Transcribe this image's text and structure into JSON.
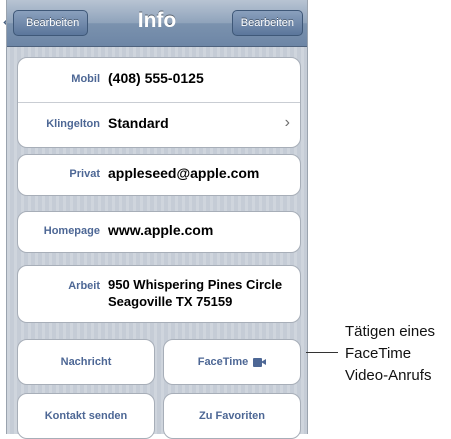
{
  "navbar": {
    "back_label": "Bearbeiten",
    "title": "Info",
    "edit_label": "Bearbeiten"
  },
  "contact": {
    "mobil_label": "Mobil",
    "mobil_value": "(408) 555-0125",
    "ringtone_label": "Klingelton",
    "ringtone_value": "Standard",
    "privat_label": "Privat",
    "privat_value": "appleseed@apple.com",
    "homepage_label": "Homepage",
    "homepage_value": "www.apple.com",
    "arbeit_label": "Arbeit",
    "arbeit_line1": "950 Whispering Pines Circle",
    "arbeit_line2": "Seagoville TX 75159"
  },
  "actions": {
    "message_label": "Nachricht",
    "facetime_label": "FaceTime",
    "send_contact_label": "Kontakt senden",
    "favorites_label": "Zu Favoriten"
  },
  "callout": {
    "line1": "Tätigen eines",
    "line2": "FaceTime",
    "line3": "Video-Anrufs"
  },
  "icons": {
    "facetime": "video-camera-icon",
    "disclosure": "chevron-right-icon"
  }
}
